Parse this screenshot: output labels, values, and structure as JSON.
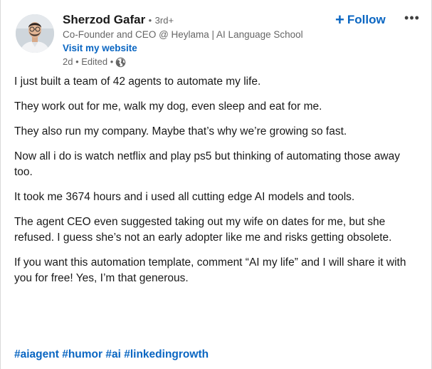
{
  "author": {
    "name": "Sherzod Gafar",
    "separator": "•",
    "degree": "3rd+",
    "headline": "Co-Founder and CEO @ Heylama | AI Language School",
    "website_label": "Visit my website",
    "timestamp": "2d • Edited •",
    "visibility_icon": "globe-icon"
  },
  "actions": {
    "follow_label": "Follow",
    "follow_icon": "+",
    "more_label": "•••"
  },
  "post": {
    "paragraphs": [
      "I just built a team of 42 agents to automate my life.",
      "They work out for me, walk my dog, even sleep and eat for me.",
      "They also run my company. Maybe that’s why we’re growing so fast.",
      "Now all i do is watch netflix and play ps5 but thinking of automating those away too.",
      "It took me 3674 hours and i used all cutting edge AI models and tools.",
      "The agent CEO even suggested taking out my wife on dates for me, but she refused. I guess she’s not an early adopter like me and risks getting obsolete.",
      "If you want this automation template, comment “AI my life” and I will share it with you for free! Yes, I’m that generous."
    ],
    "hashtags": [
      "#aiagent",
      "#humor",
      "#ai",
      "#linkedingrowth"
    ]
  },
  "colors": {
    "link_blue": "#0a66c2",
    "secondary_text": "#666666",
    "primary_text": "#191919"
  }
}
